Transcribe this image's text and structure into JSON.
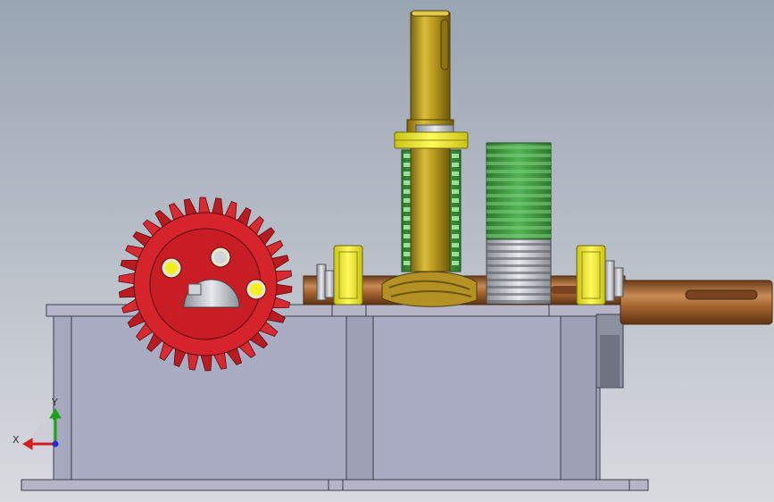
{
  "viewport": {
    "background_top": "#9aa5b3",
    "background_bottom": "#d9dbe0"
  },
  "triad": {
    "x_label": "X",
    "y_label": "Y",
    "x_color": "#d11f1f",
    "y_color": "#17a317",
    "z_color": "#2a2ad6"
  },
  "colors": {
    "housing": "#a5a8bf",
    "bevel_gear": "#d6242c",
    "spur_gear": "#3e9a3e",
    "shaft_vertical": "#b59a1c",
    "shaft_horizontal": "#9a5a2c",
    "bearing": "#f3ee22",
    "worm": "#b39124"
  }
}
